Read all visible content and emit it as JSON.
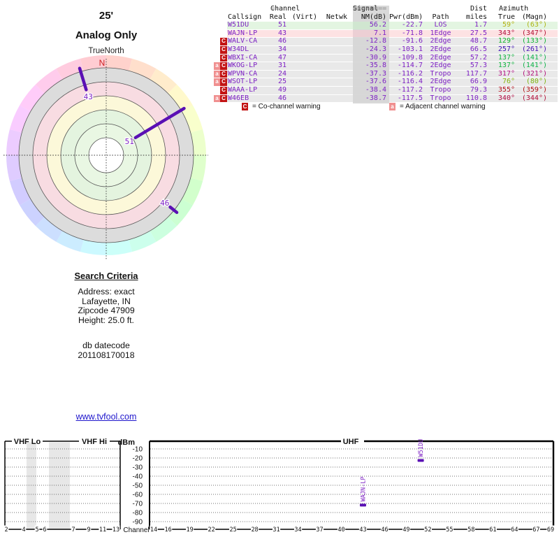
{
  "report": {
    "radar": {
      "height_label": "25'",
      "mode_label": "Analog Only",
      "north_reference": "TrueNorth",
      "north_letter": "N"
    },
    "table": {
      "header_groups": {
        "channel": {
          "pre": "==",
          "label": "Channel",
          "post": "=="
        },
        "signal": {
          "pre": "========",
          "label": "Signal",
          "post": "========"
        },
        "dist": "Dist",
        "azimuth": {
          "pre": "==",
          "label": "Azimuth",
          "post": "=="
        }
      },
      "columns": [
        "Callsign",
        "Real",
        "(Virt)",
        "Netwk",
        "NM(dB)",
        "Pwr(dBm)",
        "Path",
        "miles",
        "True",
        "(Magn)"
      ],
      "rows": [
        {
          "warn": "",
          "callsign": "W51DU",
          "real": 51,
          "nm": 56.2,
          "pwr": -22.7,
          "path": "LOS",
          "miles": 1.7,
          "true_az": 59,
          "magn_az": 63,
          "bg": "green"
        },
        {
          "warn": "",
          "callsign": "WAJN-LP",
          "real": 43,
          "nm": 7.1,
          "pwr": -71.8,
          "path": "1Edge",
          "miles": 27.5,
          "true_az": 343,
          "magn_az": 347,
          "bg": "pink"
        },
        {
          "warn": "C",
          "callsign": "WALV-CA",
          "real": 46,
          "nm": -12.8,
          "pwr": -91.6,
          "path": "2Edge",
          "miles": 48.7,
          "true_az": 129,
          "magn_az": 133,
          "bg": "gray"
        },
        {
          "warn": "C",
          "callsign": "W34DL",
          "real": 34,
          "nm": -24.3,
          "pwr": -103.1,
          "path": "2Edge",
          "miles": 66.5,
          "true_az": 257,
          "magn_az": 261,
          "bg": "gray"
        },
        {
          "warn": "C",
          "callsign": "WBXI-CA",
          "real": 47,
          "nm": -30.9,
          "pwr": -109.8,
          "path": "2Edge",
          "miles": 57.2,
          "true_az": 137,
          "magn_az": 141,
          "bg": "gray"
        },
        {
          "warn": "aC",
          "callsign": "WKOG-LP",
          "real": 31,
          "nm": -35.8,
          "pwr": -114.7,
          "path": "2Edge",
          "miles": 57.3,
          "true_az": 137,
          "magn_az": 141,
          "bg": "gray"
        },
        {
          "warn": "aC",
          "callsign": "WPVN-CA",
          "real": 24,
          "nm": -37.3,
          "pwr": -116.2,
          "path": "Tropo",
          "miles": 117.7,
          "true_az": 317,
          "magn_az": 321,
          "bg": "gray"
        },
        {
          "warn": "aC",
          "callsign": "WSOT-LP",
          "real": 25,
          "nm": -37.6,
          "pwr": -116.4,
          "path": "2Edge",
          "miles": 66.9,
          "true_az": 76,
          "magn_az": 80,
          "bg": "gray"
        },
        {
          "warn": "C",
          "callsign": "WAAA-LP",
          "real": 49,
          "nm": -38.4,
          "pwr": -117.2,
          "path": "Tropo",
          "miles": 79.3,
          "true_az": 355,
          "magn_az": 359,
          "bg": "gray"
        },
        {
          "warn": "aC",
          "callsign": "W46EB",
          "real": 46,
          "nm": -38.7,
          "pwr": -117.5,
          "path": "Tropo",
          "miles": 110.8,
          "true_az": 340,
          "magn_az": 344,
          "bg": "gray"
        }
      ],
      "legend": {
        "c_symbol": "C",
        "c_text": "=  Co-channel warning",
        "a_symbol": "a",
        "a_text": "=  Adjacent channel warning"
      }
    },
    "search_criteria": {
      "title": "Search Criteria",
      "lines": [
        "Address: exact",
        "Lafayette, IN",
        "Zipcode 47909",
        "Height: 25.0 ft."
      ],
      "db_label": "db datecode",
      "db_code": "201108170018"
    },
    "link_text": "www.tvfool.com",
    "spectrum": {
      "dbm_label": "dBm",
      "channel_label": "Channel",
      "vhf_lo_label": "VHF Lo",
      "vhf_hi_label": "VHF Hi",
      "uhf_label": "UHF",
      "dbm_ticks": [
        -10,
        -20,
        -30,
        -40,
        -50,
        -60,
        -70,
        -80,
        -90
      ],
      "vhf_channels": [
        2,
        4,
        5,
        6,
        7,
        9,
        11,
        13
      ],
      "uhf_channels": [
        14,
        16,
        19,
        22,
        25,
        28,
        31,
        34,
        37,
        40,
        43,
        46,
        49,
        52,
        55,
        58,
        61,
        64,
        67,
        69
      ],
      "markers": [
        {
          "callsign": "W51DU",
          "channel": 51,
          "pwr_dbm": -22.7
        },
        {
          "callsign": "WAJN-LP",
          "channel": 43,
          "pwr_dbm": -71.8
        }
      ]
    },
    "colors": {
      "data_purple": "#7e22c4",
      "ray_purple": "#5a10b4",
      "warn_red": "#c31414",
      "warn_pink": "#f09090",
      "link_blue": "#1f16cc",
      "north_red": "#cc2222"
    }
  },
  "chart_data": [
    {
      "type": "radar",
      "title": "25' Analog Only",
      "north_reference": "TrueNorth",
      "notes": "Pastel hue ring encodes azimuth; ring zones (strong to weak): green, yellow, pink, gray. Rays point at true azimuth, longer ray = stronger signal.",
      "rays": [
        {
          "callsign": "W51DU",
          "channel_label": "51",
          "azimuth_true_deg": 59,
          "nm_db": 56.2
        },
        {
          "callsign": "WAJN-LP",
          "channel_label": "43",
          "azimuth_true_deg": 343,
          "nm_db": 7.1
        },
        {
          "callsign": "WALV-CA",
          "channel_label": "46",
          "azimuth_true_deg": 129,
          "nm_db": -12.8
        }
      ]
    },
    {
      "type": "scatter",
      "title": "Signal power vs channel",
      "xlabel": "Channel",
      "ylabel": "dBm",
      "ylim": [
        -95,
        0
      ],
      "x_bands": [
        "VHF Lo (2-6)",
        "VHF Hi (7-13)",
        "UHF (14-69)"
      ],
      "grid": true,
      "points": [
        {
          "callsign": "W51DU",
          "x": 51,
          "y": -22.7
        },
        {
          "callsign": "WAJN-LP",
          "x": 43,
          "y": -71.8
        }
      ]
    }
  ]
}
